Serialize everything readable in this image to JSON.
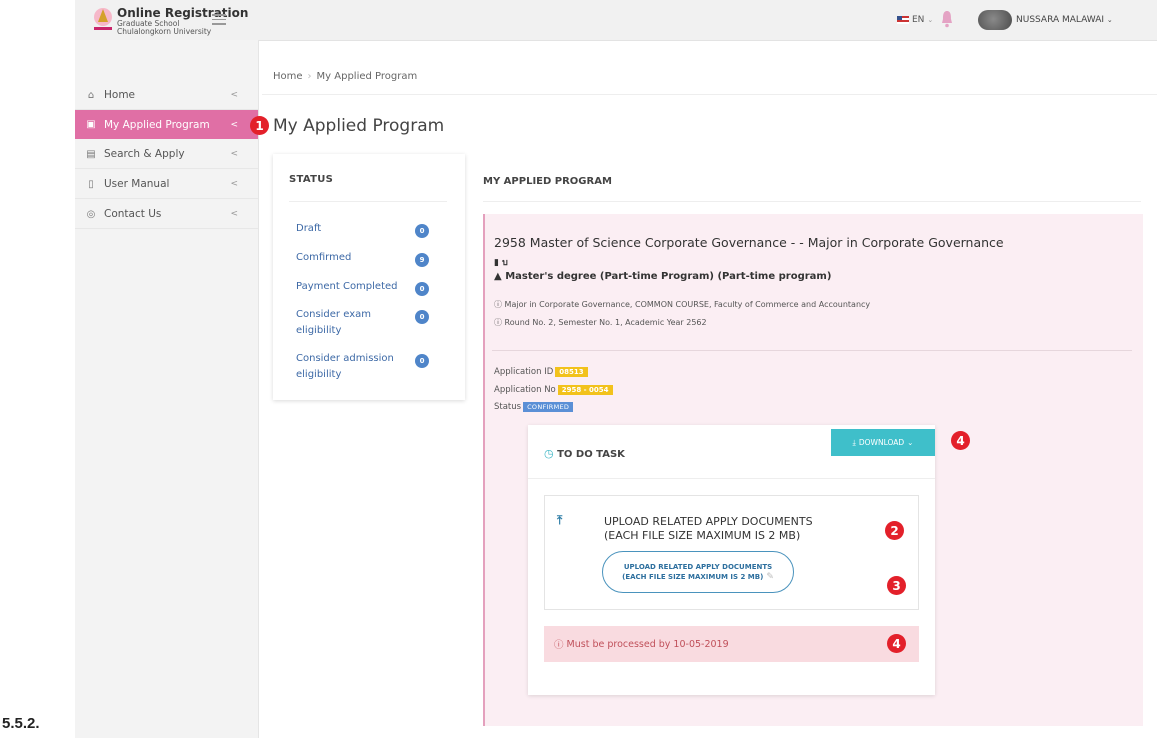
{
  "brand": {
    "title": "Online Registration",
    "line1": "Graduate School",
    "line2": "Chulalongkorn University"
  },
  "topbar": {
    "language": "EN",
    "user_name": "NUSSARA MALAWAI"
  },
  "sidebar": {
    "items": [
      {
        "label": "Home",
        "icon": "home-icon"
      },
      {
        "label": "My Applied Program",
        "icon": "briefcase-icon",
        "active": true
      },
      {
        "label": "Search & Apply",
        "icon": "catalog-icon"
      },
      {
        "label": "User Manual",
        "icon": "book-icon"
      },
      {
        "label": "Contact Us",
        "icon": "location-pin-icon"
      }
    ]
  },
  "breadcrumb": [
    "Home",
    "My Applied Program"
  ],
  "page_title": "My Applied Program",
  "status_panel": {
    "heading": "STATUS",
    "items": [
      {
        "label": "Draft",
        "count": "0"
      },
      {
        "label": "Comfirmed",
        "count": "9"
      },
      {
        "label": "Payment Completed",
        "count": "0"
      },
      {
        "label": "Consider exam eligibility",
        "count": "0"
      },
      {
        "label": "Consider admission eligibility",
        "count": "0"
      }
    ]
  },
  "applied": {
    "heading": "MY APPLIED PROGRAM",
    "program_title": "2958 Master of Science Corporate Governance - - Major in Corporate Governance",
    "book_text": "บ",
    "degree": "Master's degree (Part-time Program) (Part-time program)",
    "info_major": "Major in Corporate Governance, COMMON COURSE, Faculty of Commerce and Accountancy",
    "info_round": "Round No. 2, Semester No. 1, Academic Year 2562",
    "application_id_label": "Application ID",
    "application_id": "08513",
    "application_no_label": "Application No",
    "application_no": "2958 - 0054",
    "status_label": "Status",
    "status_value": "CONFIRMED"
  },
  "todo": {
    "heading": "TO DO TASK",
    "download_label": "DOWNLOAD",
    "upload_title_line1": "UPLOAD RELATED APPLY DOCUMENTS",
    "upload_title_line2": "(EACH FILE SIZE MAXIMUM IS 2 MB)",
    "upload_button_line1": "UPLOAD RELATED APPLY DOCUMENTS",
    "upload_button_line2": "(EACH FILE SIZE MAXIMUM IS 2 MB)",
    "deadline": "Must be processed by 10-05-2019"
  },
  "callouts": [
    "1",
    "2",
    "3",
    "4",
    "4"
  ],
  "caption": "5.5.2.",
  "colors": {
    "sidebar_active": "#e06fa5",
    "callout_red": "#e3202a",
    "download_teal": "#3fbfca",
    "tag_yellow": "#f2c21b",
    "tag_blue": "#5b8fd6"
  }
}
